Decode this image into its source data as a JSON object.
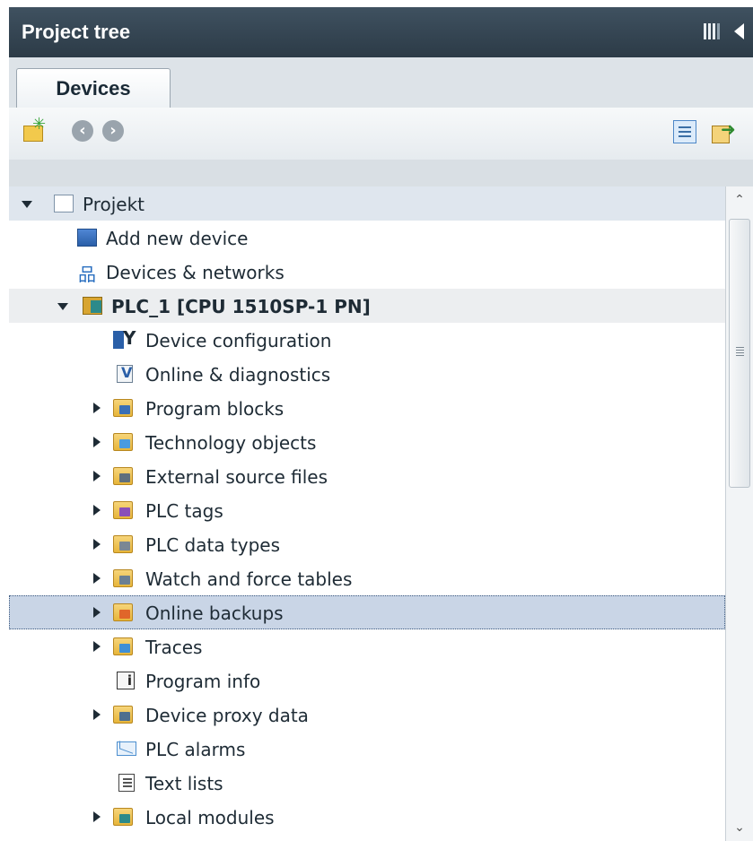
{
  "panel": {
    "title": "Project tree"
  },
  "tabs": [
    {
      "label": "Devices",
      "active": true
    }
  ],
  "toolbar": {
    "buttons": [
      {
        "icon": "new-project-icon"
      },
      {
        "icon": "back-icon"
      },
      {
        "icon": "forward-icon"
      },
      {
        "icon": "detail-view-icon"
      },
      {
        "icon": "export-icon"
      }
    ]
  },
  "tree": {
    "items": [
      {
        "label": "Projekt",
        "icon": "project-icon",
        "expander": "open"
      },
      {
        "label": "Add new device",
        "icon": "add-device-icon"
      },
      {
        "label": "Devices & networks",
        "icon": "network-icon"
      },
      {
        "label": "PLC_1 [CPU 1510SP-1 PN]",
        "icon": "plc-icon",
        "expander": "open"
      },
      {
        "label": "Device configuration",
        "icon": "device-config-icon"
      },
      {
        "label": "Online & diagnostics",
        "icon": "diagnostics-icon"
      },
      {
        "label": "Program blocks",
        "icon": "program-blocks-folder-icon",
        "expander": "closed"
      },
      {
        "label": "Technology objects",
        "icon": "technology-objects-folder-icon",
        "expander": "closed"
      },
      {
        "label": "External source files",
        "icon": "external-source-folder-icon",
        "expander": "closed"
      },
      {
        "label": "PLC tags",
        "icon": "plc-tags-folder-icon",
        "expander": "closed"
      },
      {
        "label": "PLC data types",
        "icon": "plc-data-types-folder-icon",
        "expander": "closed"
      },
      {
        "label": "Watch and force tables",
        "icon": "watch-tables-folder-icon",
        "expander": "closed"
      },
      {
        "label": "Online backups",
        "icon": "online-backups-folder-icon",
        "expander": "closed",
        "selected": true
      },
      {
        "label": "Traces",
        "icon": "traces-folder-icon",
        "expander": "closed"
      },
      {
        "label": "Program info",
        "icon": "program-info-icon"
      },
      {
        "label": "Device proxy data",
        "icon": "device-proxy-folder-icon",
        "expander": "closed"
      },
      {
        "label": "PLC alarms",
        "icon": "alarms-icon"
      },
      {
        "label": "Text lists",
        "icon": "text-lists-icon"
      },
      {
        "label": "Local modules",
        "icon": "local-modules-folder-icon",
        "expander": "closed"
      }
    ]
  },
  "scrollbar": {
    "position": 0.0
  }
}
